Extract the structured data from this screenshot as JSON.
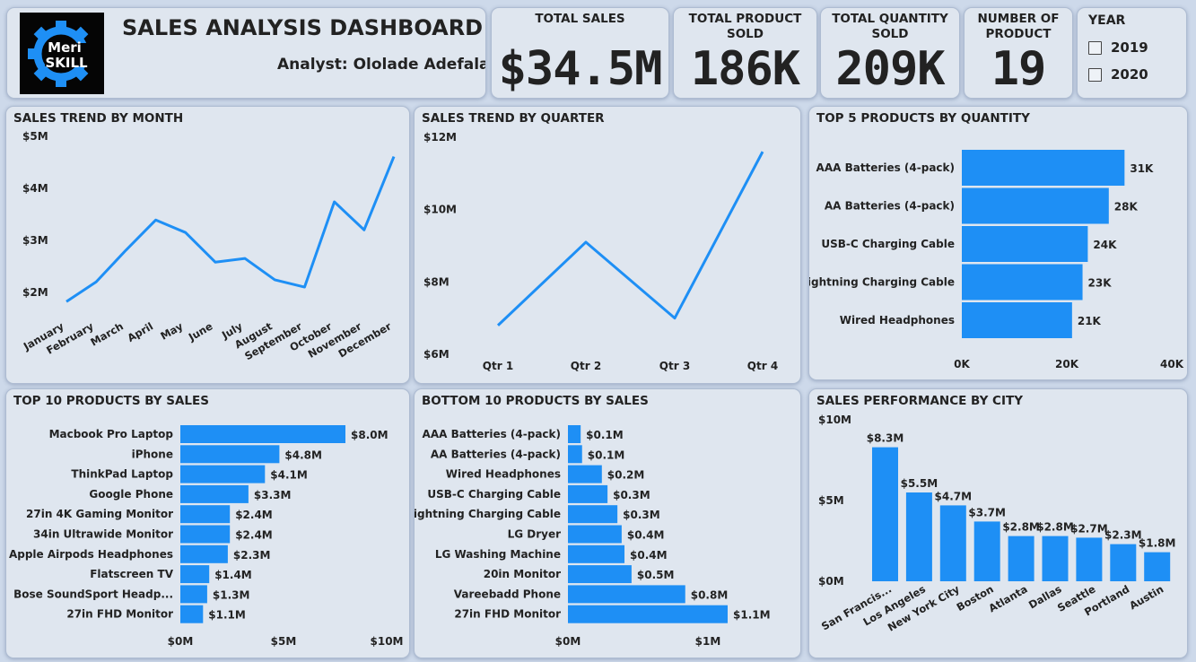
{
  "header": {
    "logo_line1": "Meri",
    "logo_line2": "SKILL",
    "title": "SALES ANALYSIS DASHBOARD",
    "analyst": "Analyst: Ololade Adefala"
  },
  "kpis": [
    {
      "label": "TOTAL SALES",
      "value": "$34.5M"
    },
    {
      "label": "TOTAL PRODUCT\nSOLD",
      "value": "186K"
    },
    {
      "label": "TOTAL QUANTITY\nSOLD",
      "value": "209K"
    },
    {
      "label": "NUMBER OF\nPRODUCT",
      "value": "19"
    }
  ],
  "year_filter": {
    "label": "YEAR",
    "options": [
      "2019",
      "2020"
    ]
  },
  "colors": {
    "accent": "#1e8ff5",
    "background": "#cdd9ea",
    "card": "#dfe6ef"
  },
  "chart_data": [
    {
      "type": "line",
      "title": "SALES TREND BY MONTH",
      "categories": [
        "January",
        "February",
        "March",
        "April",
        "May",
        "June",
        "July",
        "August",
        "September",
        "October",
        "November",
        "December"
      ],
      "values": [
        1.82,
        2.2,
        2.81,
        3.39,
        3.15,
        2.58,
        2.65,
        2.24,
        2.1,
        3.74,
        3.2,
        4.61
      ],
      "yticks": [
        "$2M",
        "$3M",
        "$4M",
        "$5M"
      ],
      "ylim": [
        1.6,
        5.0
      ]
    },
    {
      "type": "line",
      "title": "SALES TREND BY QUARTER",
      "categories": [
        "Qtr 1",
        "Qtr 2",
        "Qtr 3",
        "Qtr 4"
      ],
      "values": [
        6.8,
        9.1,
        7.0,
        11.6
      ],
      "yticks": [
        "$6M",
        "$8M",
        "$10M",
        "$12M"
      ],
      "ylim": [
        6,
        12
      ]
    },
    {
      "type": "bar",
      "orientation": "horizontal",
      "title": "TOP 5 PRODUCTS BY QUANTITY",
      "categories": [
        "AAA Batteries (4-pack)",
        "AA Batteries (4-pack)",
        "USB-C Charging Cable",
        "Lightning Charging Cable",
        "Wired Headphones"
      ],
      "values": [
        31,
        28,
        24,
        23,
        21
      ],
      "data_labels": [
        "31K",
        "28K",
        "24K",
        "23K",
        "21K"
      ],
      "xticks": [
        "0K",
        "20K",
        "40K"
      ],
      "xlim": [
        0,
        40
      ]
    },
    {
      "type": "bar",
      "orientation": "horizontal",
      "title": "TOP 10 PRODUCTS BY SALES",
      "categories": [
        "Macbook Pro Laptop",
        "iPhone",
        "ThinkPad Laptop",
        "Google Phone",
        "27in 4K Gaming Monitor",
        "34in Ultrawide Monitor",
        "Apple Airpods Headphones",
        "Flatscreen TV",
        "Bose SoundSport Headp...",
        "27in FHD Monitor"
      ],
      "values": [
        8.0,
        4.8,
        4.1,
        3.3,
        2.4,
        2.4,
        2.3,
        1.4,
        1.3,
        1.1
      ],
      "data_labels": [
        "$8.0M",
        "$4.8M",
        "$4.1M",
        "$3.3M",
        "$2.4M",
        "$2.4M",
        "$2.3M",
        "$1.4M",
        "$1.3M",
        "$1.1M"
      ],
      "xticks": [
        "$0M",
        "$5M",
        "$10M"
      ],
      "xlim": [
        0,
        10
      ]
    },
    {
      "type": "bar",
      "orientation": "horizontal",
      "title": "BOTTOM 10 PRODUCTS BY SALES",
      "categories": [
        "AAA Batteries (4-pack)",
        "AA Batteries (4-pack)",
        "Wired Headphones",
        "USB-C Charging Cable",
        "Lightning Charging Cable",
        "LG Dryer",
        "LG Washing Machine",
        "20in Monitor",
        "Vareebadd Phone",
        "27in FHD Monitor"
      ],
      "values": [
        0.09,
        0.1,
        0.24,
        0.28,
        0.35,
        0.38,
        0.4,
        0.45,
        0.83,
        1.13
      ],
      "data_labels": [
        "$0.1M",
        "$0.1M",
        "$0.2M",
        "$0.3M",
        "$0.3M",
        "$0.4M",
        "$0.4M",
        "$0.5M",
        "$0.8M",
        "$1.1M"
      ],
      "xticks": [
        "$0M",
        "$1M"
      ],
      "xlim": [
        0,
        1.13
      ]
    },
    {
      "type": "bar",
      "orientation": "vertical",
      "title": "SALES PERFORMANCE BY CITY",
      "categories": [
        "San Francis...",
        "Los Angeles",
        "New York City",
        "Boston",
        "Atlanta",
        "Dallas",
        "Seattle",
        "Portland",
        "Austin"
      ],
      "values": [
        8.3,
        5.5,
        4.7,
        3.7,
        2.8,
        2.8,
        2.7,
        2.3,
        1.8
      ],
      "data_labels": [
        "$8.3M",
        "$5.5M",
        "$4.7M",
        "$3.7M",
        "$2.8M",
        "$2.8M",
        "$2.7M",
        "$2.3M",
        "$1.8M"
      ],
      "yticks": [
        "$0M",
        "$5M",
        "$10M"
      ],
      "ylim": [
        0,
        10
      ]
    }
  ]
}
